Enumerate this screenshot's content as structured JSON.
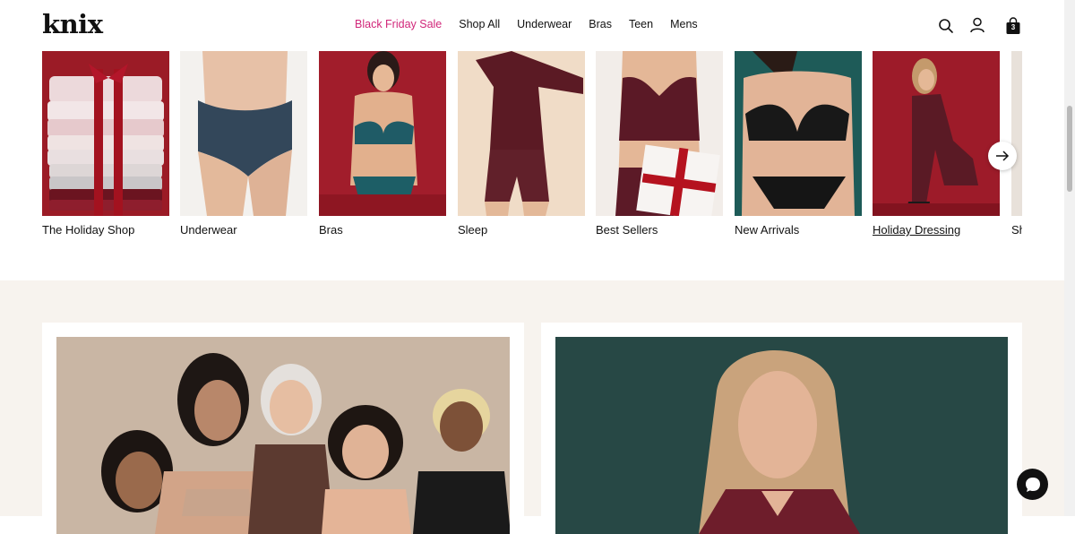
{
  "brand": {
    "logo": "knix"
  },
  "nav": {
    "items": [
      "Black Friday Sale",
      "Shop All",
      "Underwear",
      "Bras",
      "Teen",
      "Mens"
    ]
  },
  "header_icons": {
    "search": "search-icon",
    "account": "user-icon",
    "cart": "shopping-bag-icon",
    "cart_count": "3"
  },
  "categories": [
    {
      "label": "The Holiday Shop",
      "active": false
    },
    {
      "label": "Underwear",
      "active": false
    },
    {
      "label": "Bras",
      "active": false
    },
    {
      "label": "Sleep",
      "active": false
    },
    {
      "label": "Best Sellers",
      "active": false
    },
    {
      "label": "New Arrivals",
      "active": false
    },
    {
      "label": "Holiday Dressing",
      "active": true
    },
    {
      "label": "Sh",
      "active": false
    }
  ],
  "colors": {
    "sale": "#d1277a",
    "section_bg": "#f7f3ee",
    "holiday_red": "#9b1b26",
    "burgundy": "#5e1a24",
    "teal": "#1e5b58",
    "panel_green": "#274845"
  }
}
